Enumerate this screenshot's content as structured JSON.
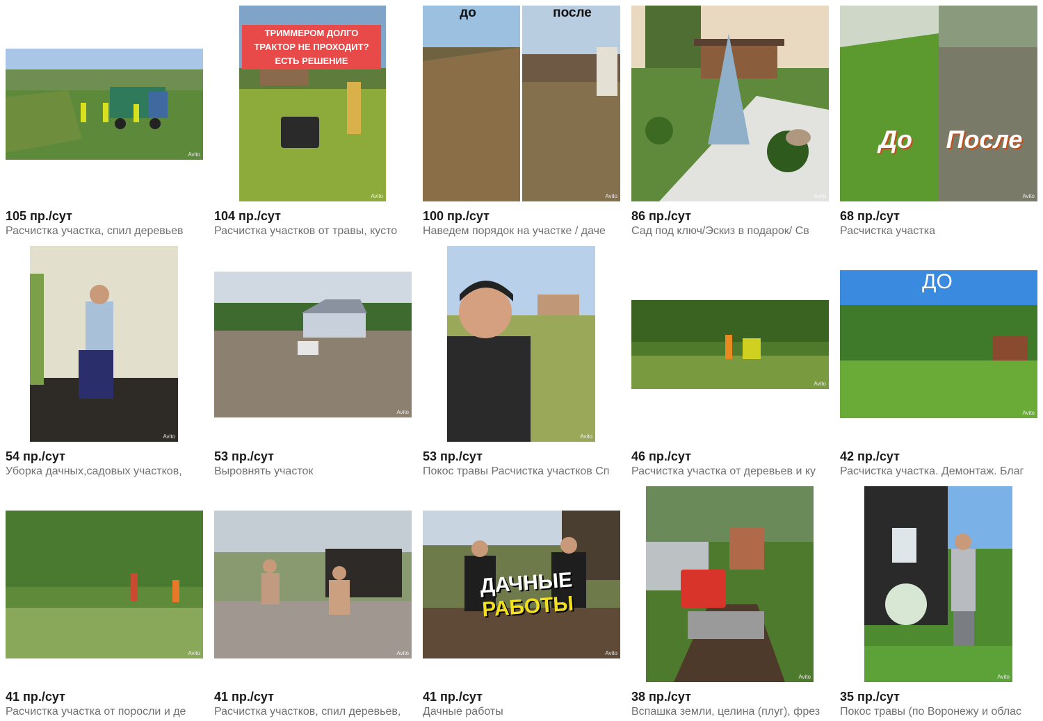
{
  "watermark": "Avito",
  "listings": [
    {
      "price": "105 пр./сут",
      "title": "Расчистка участка, спил деревьев",
      "image": "workers-loading-truck"
    },
    {
      "price": "104 пр./сут",
      "title": "Расчистка участков от травы, кусто",
      "image": "tracked-mulcher-in-grass",
      "overlay": [
        "ТРИММЕРОМ ДОЛГО",
        "ТРАКТОР НЕ ПРОХОДИТ?",
        "ЕСТЬ РЕШЕНИЕ"
      ]
    },
    {
      "price": "100 пр./сут",
      "title": "Наведем порядок на участке / даче",
      "image": "before-after-lot",
      "overlay": [
        "до",
        "после"
      ]
    },
    {
      "price": "86 пр./сут",
      "title": "Сад под ключ/Эскиз в подарок/ Св",
      "image": "landscaped-garden-blue-spruce"
    },
    {
      "price": "68 пр./сут",
      "title": "Расчистка участка",
      "image": "before-after-lawn",
      "overlay": [
        "До",
        "После"
      ]
    },
    {
      "price": "54 пр./сут",
      "title": "Уборка дачных,садовых участков,",
      "image": "man-digging-by-fence"
    },
    {
      "price": "53 пр./сут",
      "title": "Выровнять участок",
      "image": "leveled-lot-house-loader"
    },
    {
      "price": "53 пр./сут",
      "title": "Покос травы Расчистка участков Сп",
      "image": "man-selfie-field"
    },
    {
      "price": "46 пр./сут",
      "title": "Расчистка участка от деревьев и ку",
      "image": "workers-clearing-brush"
    },
    {
      "price": "42 пр./сут",
      "title": "Расчистка участка. Демонтаж. Благ",
      "image": "overgrown-lot-before",
      "overlay": [
        "ДО"
      ]
    },
    {
      "price": "41 пр./сут",
      "title": "Расчистка участка от поросли и де",
      "image": "workers-in-young-trees"
    },
    {
      "price": "41 пр./сут",
      "title": "Расчистка участков, спил деревьев,",
      "image": "men-with-chainsaws"
    },
    {
      "price": "41 пр./сут",
      "title": "Дачные работы",
      "image": "two-men-dacha-work",
      "overlay": [
        "ДАЧНЫЕ",
        "РАБОТЫ"
      ]
    },
    {
      "price": "38 пр./сут",
      "title": "Вспашка земли, целина (плуг), фрез",
      "image": "tractor-tilling-path"
    },
    {
      "price": "35 пр./сут",
      "title": "Покос травы (по Воронежу и облас",
      "image": "man-with-trimmer"
    }
  ]
}
